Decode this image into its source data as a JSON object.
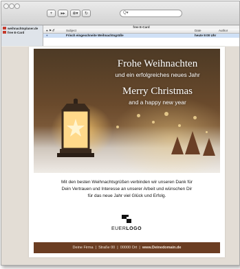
{
  "toolbar": {
    "buttons": [
      "+",
      "▸▸",
      "⊕▾",
      "↻"
    ],
    "search_placeholder": "Q▾"
  },
  "sidebar": {
    "accounts": [
      {
        "name": "weihnachtsplaner.de"
      },
      {
        "name": "free E-Card"
      }
    ]
  },
  "message_list": {
    "title": "free E-Card",
    "columns": {
      "flags": "● ⚑ 𝒪",
      "subject": "Subject",
      "date": "Date",
      "author": "Author"
    },
    "rows": [
      {
        "flag": "●",
        "subject": "Frisch eingeschneite Weihnachtsgrüße",
        "date": "heute 9:00 Uhr",
        "author": ""
      }
    ]
  },
  "email": {
    "hero": {
      "line1": "Frohe Weihnachten",
      "line2": "und ein erfolgreiches neues Jahr",
      "line3": "Merry Christmas",
      "line4": "and a happy new year"
    },
    "body_lines": [
      "Mit den besten Weihnachtsgrüßen verbinden wir unseren Dank für",
      "Dein Vertrauen und Interesse an unserer Arbeit und wünschen Dir",
      "für das neue Jahr viel Glück und Erfolg."
    ],
    "logo": {
      "prefix": "EUER",
      "suffix": "LOGO"
    },
    "footer": {
      "company": "Deine Firma",
      "street": "Straße 00",
      "city": "00000 Ort",
      "website": "www.Deinedomain.de",
      "separator": "|"
    }
  },
  "colors": {
    "footer_bg": "#6b3d22",
    "selected_row": "#cfe0f6",
    "account_icon": "#c53a2b"
  }
}
